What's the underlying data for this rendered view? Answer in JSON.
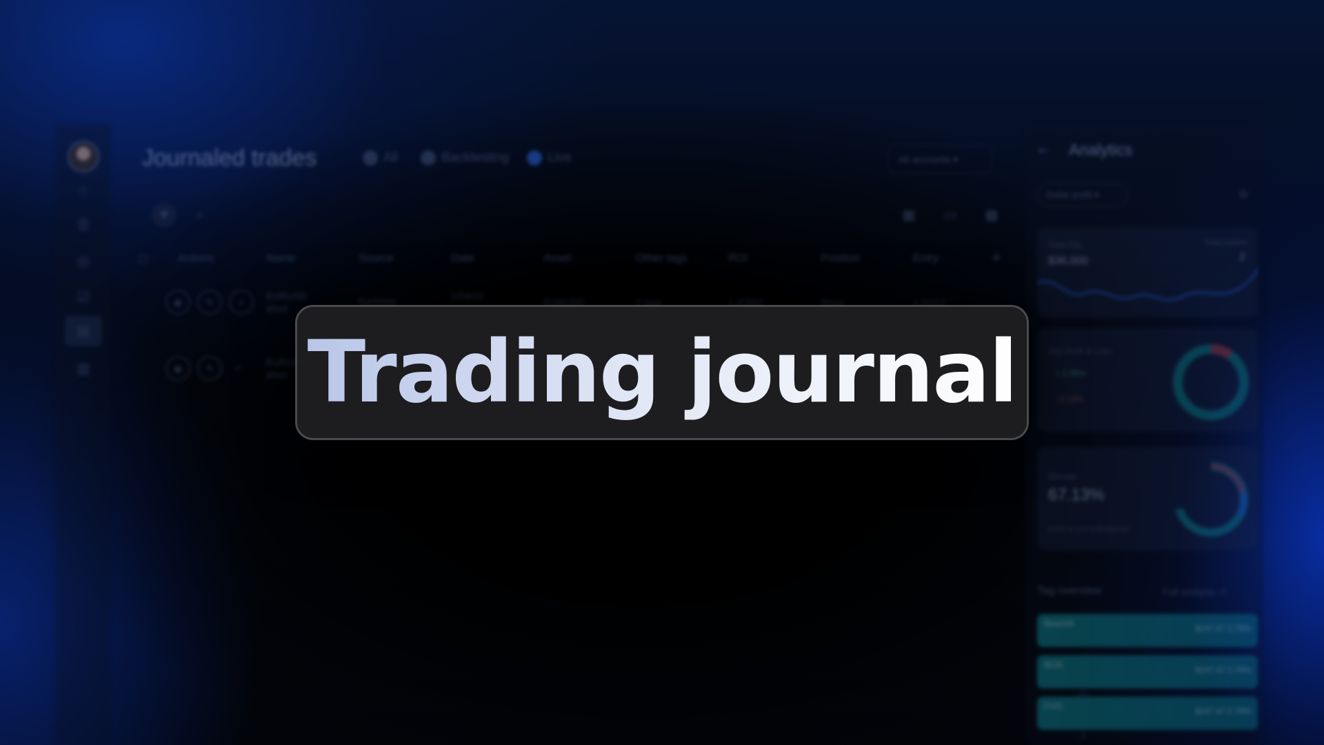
{
  "app": {
    "title": "Journaled trades",
    "filters": [
      "All",
      "Backtesting",
      "Live"
    ],
    "accounts_dropdown": "All accounts"
  },
  "table": {
    "headers": [
      "Actions",
      "Name",
      "Source",
      "Date",
      "Asset",
      "Other tags",
      "ROI",
      "Position",
      "Entry"
    ],
    "rows": [
      {
        "name": "EURUSD short",
        "source": "Backtest",
        "date": "1/04/22",
        "asset": "EURUSD",
        "other_tags": "2 tags",
        "roi": "1.47802",
        "position": "Short",
        "entry": "1.11112"
      },
      {
        "name": "EURUSD short"
      }
    ]
  },
  "analytics": {
    "title": "Analytics",
    "metric_dropdown": "Dollar profit",
    "total_pnl_label": "Total P&L",
    "total_pnl": "$36,000",
    "total_trades_label": "Total trades",
    "total_trades": "2",
    "avg_label": "Avg Profit & Loss",
    "avg_gain": "+ 2.89%",
    "avg_loss": "- 0.19%",
    "winrate_label": "Winrate",
    "winrate": "67.13%",
    "winrate_legend": "● Win  ● Loss  ● Breakeven",
    "tag_overview_label": "Tag overview",
    "full_analysis_link": "Full analysis",
    "tags": [
      {
        "name": "Bearish",
        "value": "$247.47  2.79%"
      },
      {
        "name": "BOS",
        "value": "$247.47  2.79%"
      },
      {
        "name": "FVG",
        "value": "$247.47  2.79%"
      }
    ]
  },
  "headline": "Trading journal",
  "colors": {
    "accent_blue": "#2a63d8",
    "tag_teal": "#0f8a9a",
    "panel_dark": "#202022"
  }
}
